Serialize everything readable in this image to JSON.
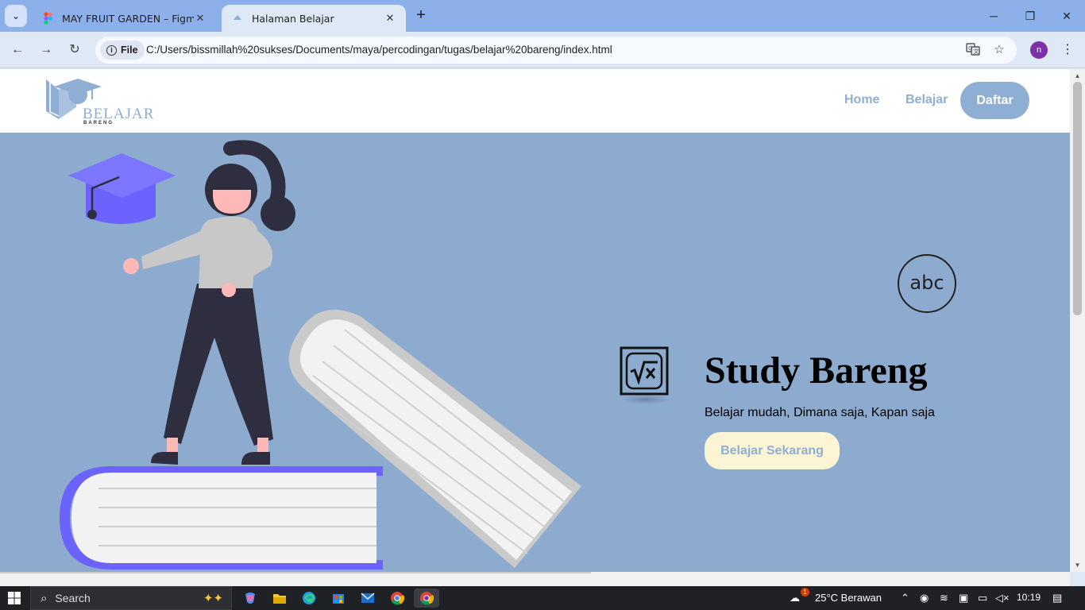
{
  "browser": {
    "tabs": [
      {
        "title": "MAY FRUIT GARDEN – Figma",
        "favicon": "figma-icon",
        "active": false
      },
      {
        "title": "Halaman Belajar",
        "favicon": "page-icon",
        "active": true
      }
    ],
    "address": {
      "scheme_chip": "File",
      "url": "C:/Users/bissmillah%20sukses/Documents/maya/percodingan/tugas/belajar%20bareng/index.html"
    },
    "profile_initial": "n"
  },
  "site": {
    "logo": {
      "name": "BELAJAR",
      "sub": "BARENG"
    },
    "nav": {
      "home": "Home",
      "belajar": "Belajar",
      "daftar": "Daftar"
    },
    "hero": {
      "title": "Study Bareng",
      "subtitle": "Belajar mudah, Dimana saja, Kapan saja",
      "cta": "Belajar Sekarang",
      "abc_icon_text": "abc"
    },
    "colors": {
      "accent": "#8eaed3",
      "hero_bg": "#8dabcf",
      "cta_bg": "#fbf5d6",
      "cap": "#6c63ff"
    }
  },
  "taskbar": {
    "search_placeholder": "Search",
    "weather": "25°C  Berawan",
    "weather_badge": "1",
    "time": "10:19"
  }
}
